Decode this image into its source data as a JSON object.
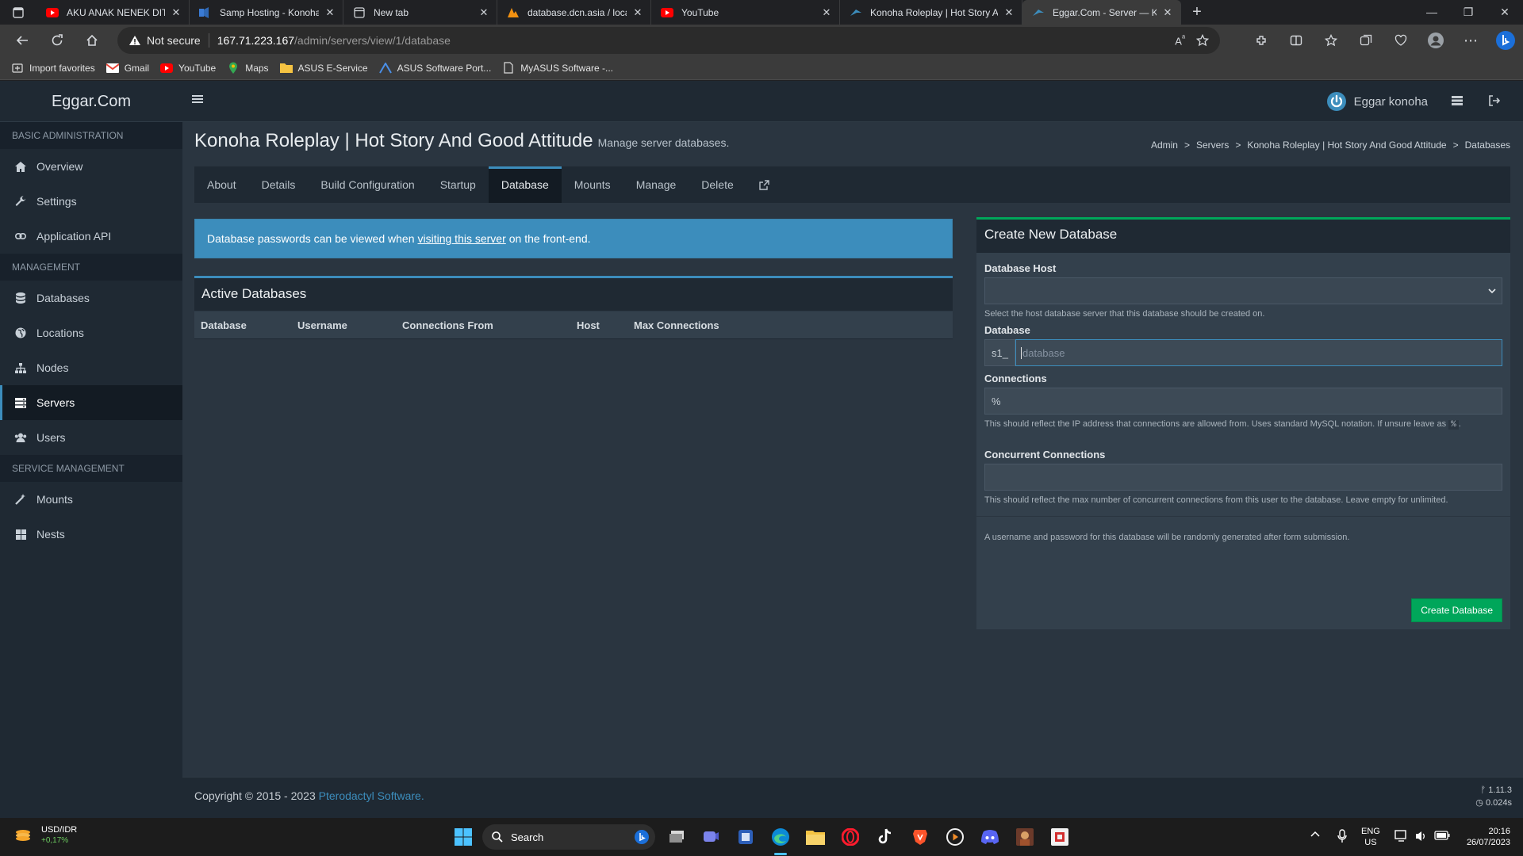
{
  "browser": {
    "tabs": [
      {
        "title": "AKU ANAK NENEK DITINGGAL A",
        "icon": "youtube-icon"
      },
      {
        "title": "Samp Hosting - Konoha Role",
        "icon": "speaker-icon"
      },
      {
        "title": "New tab",
        "icon": "new-tab-icon"
      },
      {
        "title": "database.dcn.asia / localhost / s",
        "icon": "phpmyadmin-icon"
      },
      {
        "title": "YouTube",
        "icon": "youtube-icon"
      },
      {
        "title": "Konoha Roleplay | Hot Story And",
        "icon": "pterodactyl-icon"
      },
      {
        "title": "Eggar.Com - Server — Konoha R",
        "icon": "pterodactyl-icon"
      }
    ],
    "security": "Not secure",
    "url_host": "167.71.223.167",
    "url_path": "/admin/servers/view/1/database",
    "bookmarks": [
      "Import favorites",
      "Gmail",
      "YouTube",
      "Maps",
      "ASUS E-Service",
      "ASUS Software Port...",
      "MyASUS Software -..."
    ]
  },
  "app": {
    "brand": "Eggar.Com",
    "user_name": "Eggar konoha"
  },
  "sidebar": {
    "sections": [
      {
        "title": "BASIC ADMINISTRATION",
        "items": [
          {
            "label": "Overview",
            "icon": "home-icon"
          },
          {
            "label": "Settings",
            "icon": "wrench-icon"
          },
          {
            "label": "Application API",
            "icon": "link-icon"
          }
        ]
      },
      {
        "title": "MANAGEMENT",
        "items": [
          {
            "label": "Databases",
            "icon": "database-icon"
          },
          {
            "label": "Locations",
            "icon": "globe-icon"
          },
          {
            "label": "Nodes",
            "icon": "sitemap-icon"
          },
          {
            "label": "Servers",
            "icon": "server-icon",
            "active": true
          },
          {
            "label": "Users",
            "icon": "users-icon"
          }
        ]
      },
      {
        "title": "SERVICE MANAGEMENT",
        "items": [
          {
            "label": "Mounts",
            "icon": "magic-icon"
          },
          {
            "label": "Nests",
            "icon": "grid-icon"
          }
        ]
      }
    ]
  },
  "page": {
    "title": "Konoha Roleplay | Hot Story And Good Attitude",
    "subtitle": "Manage server databases.",
    "breadcrumb": [
      "Admin",
      "Servers",
      "Konoha Roleplay | Hot Story And Good Attitude",
      "Databases"
    ],
    "tabs": [
      "About",
      "Details",
      "Build Configuration",
      "Startup",
      "Database",
      "Mounts",
      "Manage",
      "Delete"
    ],
    "active_tab": "Database",
    "callout": {
      "before": "Database passwords can be viewed when",
      "link": "visiting this server",
      "after": "on the front-end."
    }
  },
  "active_databases": {
    "title": "Active Databases",
    "columns": [
      "Database",
      "Username",
      "Connections From",
      "Host",
      "Max Connections"
    ],
    "rows": []
  },
  "create_database": {
    "title": "Create New Database",
    "host_label": "Database Host",
    "host_value": "",
    "host_help": "Select the host database server that this database should be created on.",
    "db_label": "Database",
    "db_prefix": "s1_",
    "db_placeholder": "database",
    "conn_label": "Connections",
    "conn_value": "%",
    "conn_help_before": "This should reflect the IP address that connections are allowed from. Uses standard MySQL notation. If unsure leave as",
    "conn_help_code": "%",
    "conn_help_after": ".",
    "concurrent_label": "Concurrent Connections",
    "concurrent_value": "",
    "concurrent_help": "This should reflect the max number of concurrent connections from this user to the database. Leave empty for unlimited.",
    "footer_note": "A username and password for this database will be randomly generated after form submission.",
    "submit_label": "Create Database"
  },
  "footer": {
    "copyright": "Copyright © 2015 - 2023",
    "link": "Pterodactyl Software",
    "version": "1.11.3",
    "time": "0.024s"
  },
  "taskbar": {
    "widget_title": "USD/IDR",
    "widget_value": "+0,17%",
    "search_label": "Search",
    "lang": "ENG",
    "region": "US",
    "time": "20:16",
    "date": "26/07/2023"
  },
  "colors": {
    "accent": "#3c8dbc",
    "success": "#00a65a",
    "sidebar": "#1f2933",
    "content": "#2a3540"
  }
}
